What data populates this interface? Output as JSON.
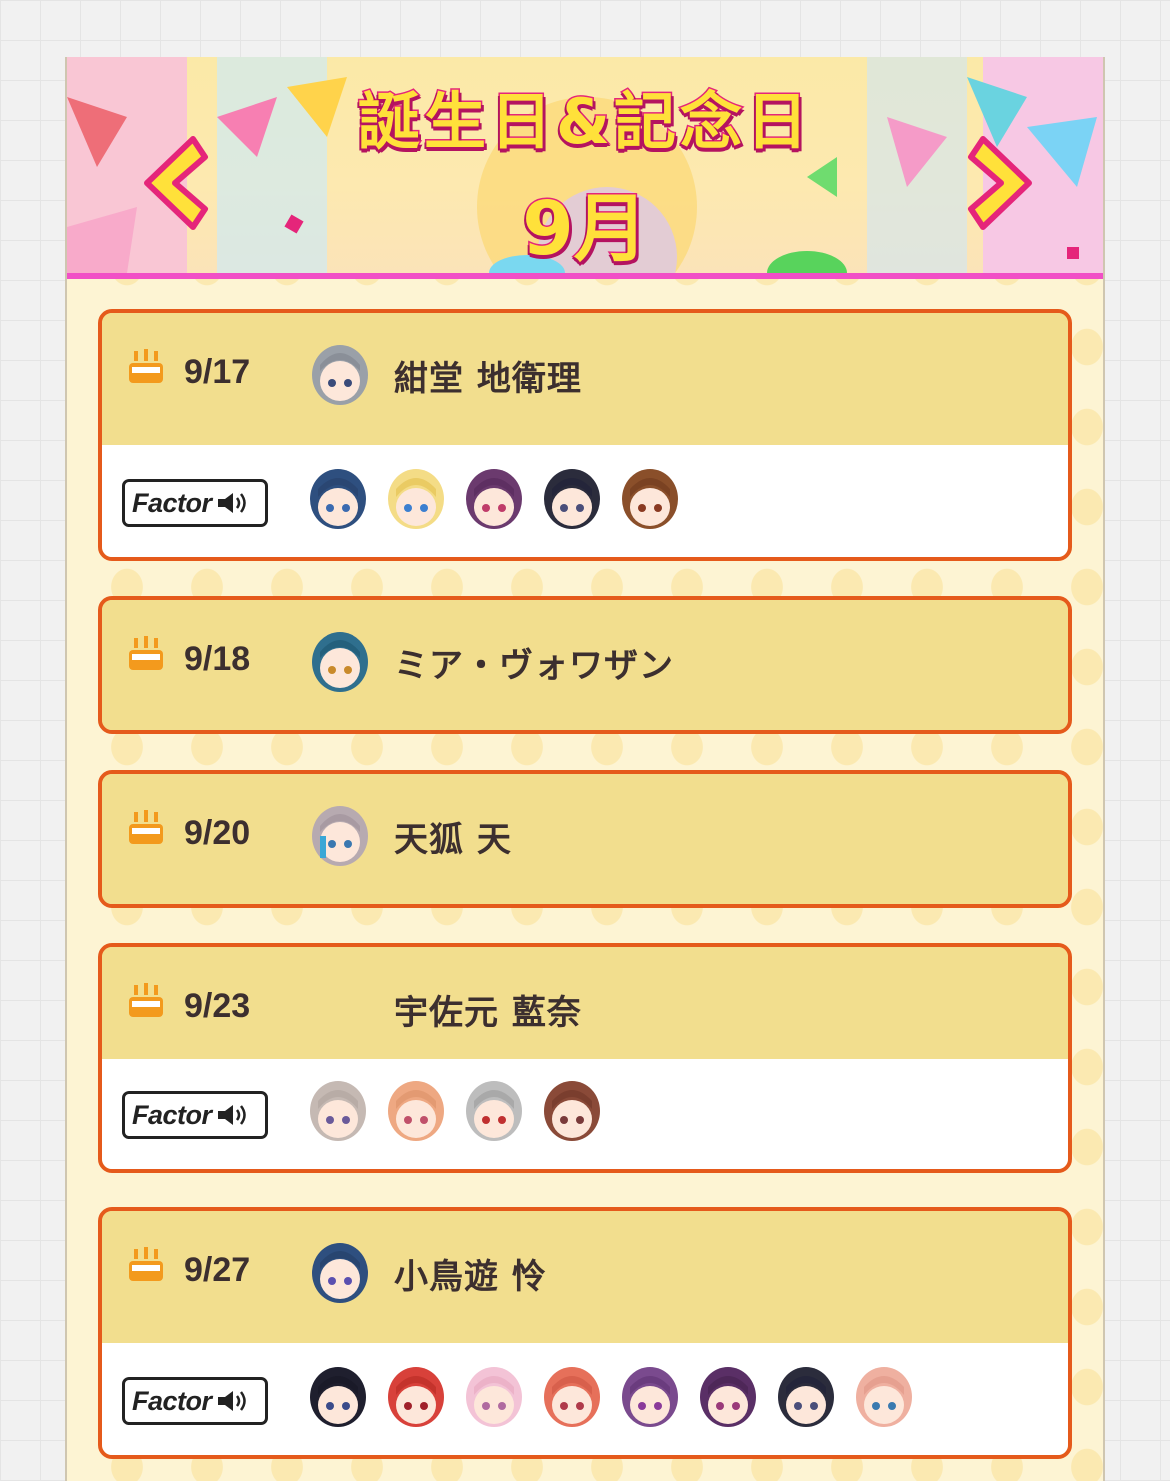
{
  "banner": {
    "title": "誕生日&記念日",
    "month": "9月",
    "prev_icon": "chevron-left-icon",
    "next_icon": "chevron-right-icon"
  },
  "colors": {
    "card_border": "#e55a1b",
    "card_header": "#f2de8e",
    "banner_stripe": "#f14fc6"
  },
  "entries": [
    {
      "date": "9/17",
      "name": "紺堂 地衛理",
      "factor_label": "Factor",
      "factor_count": 5
    },
    {
      "date": "9/18",
      "name": "ミア・ヴォワザン"
    },
    {
      "date": "9/20",
      "name": "天狐 天"
    },
    {
      "date": "9/23",
      "name": "宇佐元 藍奈",
      "factor_label": "Factor",
      "factor_count": 4
    },
    {
      "date": "9/27",
      "name": "小鳥遊 怜",
      "factor_label": "Factor",
      "factor_count": 8
    }
  ]
}
